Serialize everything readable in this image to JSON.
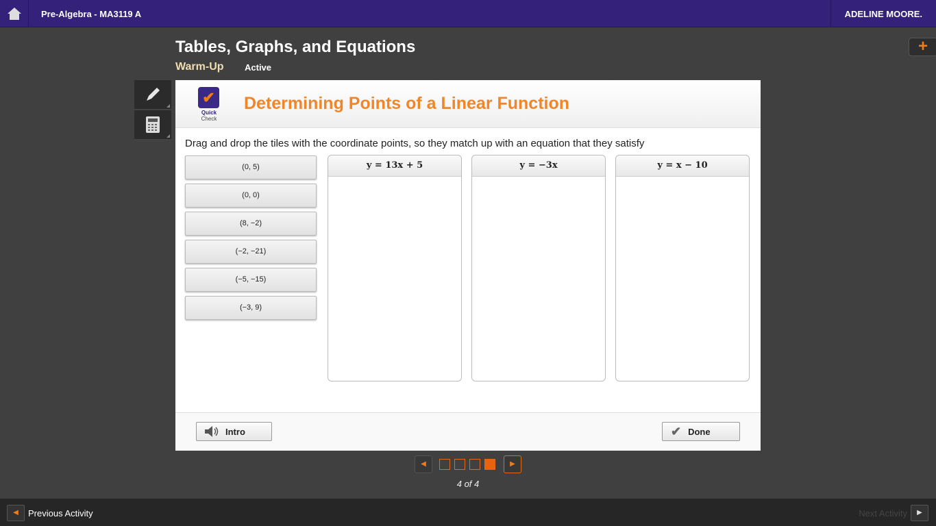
{
  "topbar": {
    "course": "Pre-Algebra - MA3119 A",
    "user": "ADELINE MOORE."
  },
  "lesson": {
    "title": "Tables, Graphs, and Equations",
    "section": "Warm-Up",
    "status": "Active"
  },
  "card": {
    "badge_line1": "Quick",
    "badge_line2": "Check",
    "title": "Determining Points of a Linear Function",
    "instructions": "Drag and drop the tiles with the coordinate points, so they match up with an equation that they satisfy",
    "tiles": [
      "(0, 5)",
      "(0, 0)",
      "(8, −2)",
      "(−2, −21)",
      "(−5, −15)",
      "(−3, 9)"
    ],
    "columns": [
      "y = 13x + 5",
      "y = −3x",
      "y = x − 10"
    ],
    "intro_label": "Intro",
    "done_label": "Done"
  },
  "pager": {
    "text": "4 of 4",
    "current": 4,
    "total": 4
  },
  "bottom": {
    "prev": "Previous Activity",
    "next": "Next Activity"
  },
  "colors": {
    "brand": "#33217a",
    "accent": "#f07c1a"
  }
}
